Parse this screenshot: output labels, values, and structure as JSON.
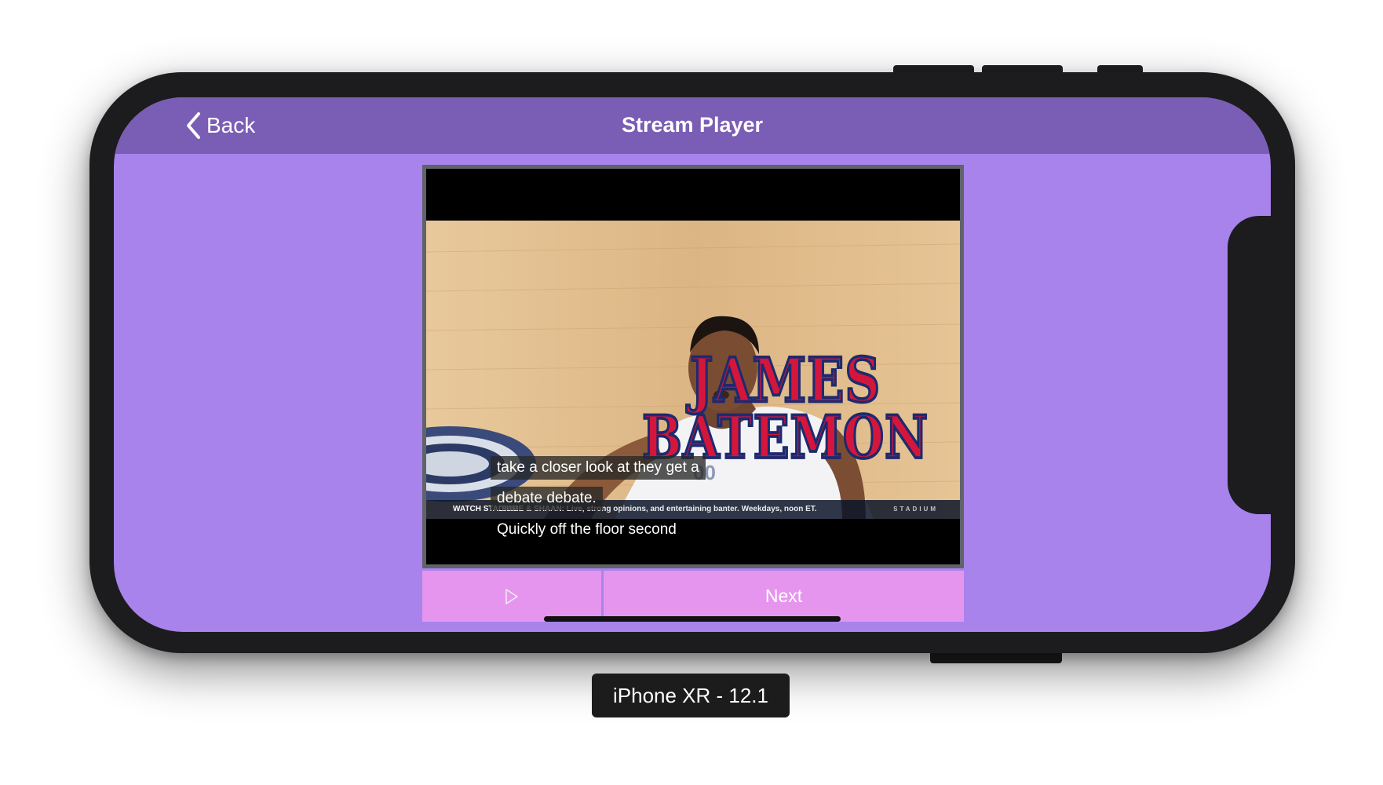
{
  "nav": {
    "back_label": "Back",
    "title": "Stream Player"
  },
  "video": {
    "overlay_name_line1": "JAMES",
    "overlay_name_line2": "BATEMON",
    "ticker_label": "WATCH STADIUM",
    "ticker_text": "SAGE & SHAAN: Live, strong opinions, and entertaining banter. Weekdays, noon ET.",
    "ticker_logo": "STADIUM",
    "captions": [
      "take a closer look at they get a",
      "debate debate.",
      "Quickly off the floor second"
    ]
  },
  "controls": {
    "play_icon": "play-outline-icon",
    "next_label": "Next"
  },
  "device_label": "iPhone XR - 12.1",
  "colors": {
    "nav_bg": "#7a5db4",
    "screen_bg": "#a783eb",
    "button_bg": "#e595ee",
    "name_red": "#d4163d",
    "name_outline": "#1d2a6e"
  }
}
